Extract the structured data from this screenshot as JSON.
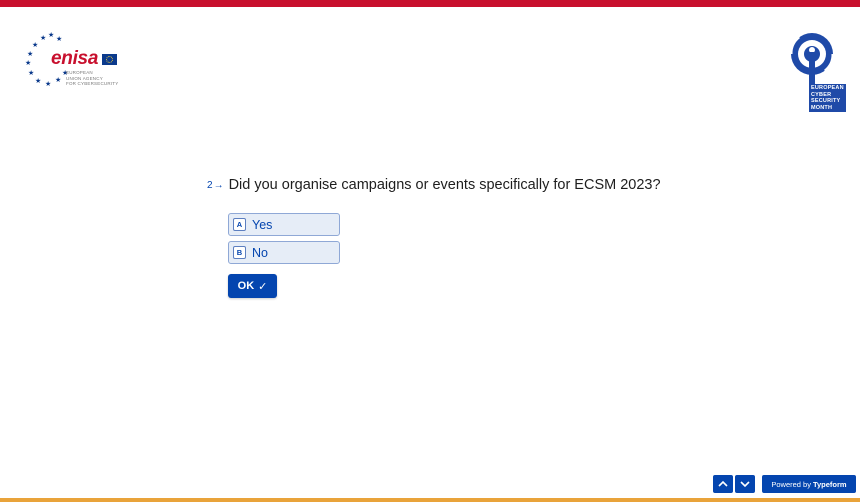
{
  "branding": {
    "left_logo_word": "enisa",
    "left_logo_subtitle": [
      "EUROPEAN",
      "UNION AGENCY",
      "FOR CYBERSECURITY"
    ],
    "right_logo_lines": [
      "EUROPEAN",
      "CYBER",
      "SECURITY",
      "MONTH"
    ],
    "colors": {
      "top_bar": "#c8102e",
      "bottom_bar": "#e9a33a",
      "accent": "#0445af"
    }
  },
  "question": {
    "number": "2",
    "arrow_icon": "arrow-right-icon",
    "text": "Did you organise campaigns or events specifically for ECSM 2023?"
  },
  "options": [
    {
      "key": "A",
      "label": "Yes"
    },
    {
      "key": "B",
      "label": "No"
    }
  ],
  "ok_button": {
    "label": "OK",
    "icon": "check-icon"
  },
  "footer": {
    "nav_up_icon": "chevron-up-icon",
    "nav_down_icon": "chevron-down-icon",
    "powered_prefix": "Powered by",
    "powered_brand": "Typeform"
  }
}
